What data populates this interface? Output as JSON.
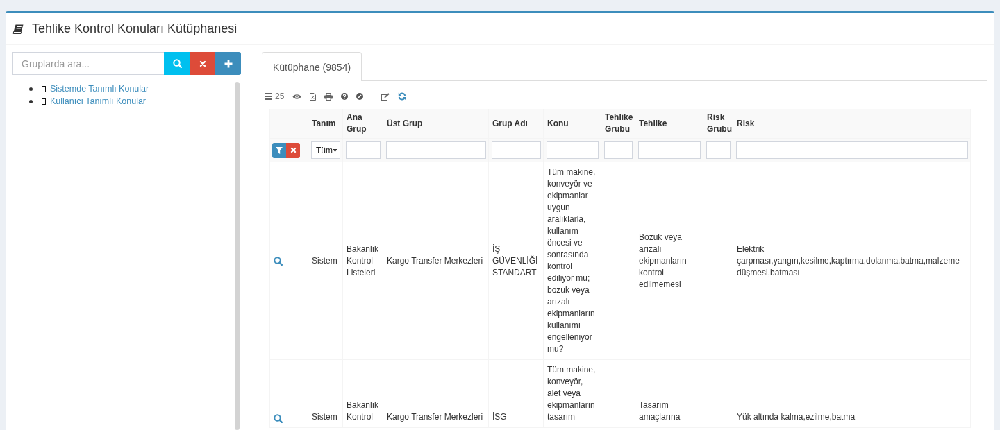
{
  "header": {
    "title": "Tehlike Kontrol Konuları Kütüphanesi"
  },
  "sidebar": {
    "search": {
      "placeholder": "Gruplarda ara..."
    },
    "buttons": [
      {
        "kind": "search"
      },
      {
        "kind": "clear"
      },
      {
        "kind": "add"
      }
    ],
    "tree": [
      {
        "label": "Sistemde Tanımlı Konular"
      },
      {
        "label": "Kullanıcı Tanımlı Konular"
      }
    ]
  },
  "tabs": [
    {
      "label": "Kütüphane (9854)",
      "selected": true
    }
  ],
  "toolbar": [
    {
      "items": [
        {
          "kind": "page_size",
          "label": "25"
        },
        {
          "kind": "columns"
        },
        {
          "kind": "excel"
        },
        {
          "kind": "print"
        },
        {
          "kind": "help"
        },
        {
          "kind": "reset"
        }
      ]
    },
    {
      "items": [
        {
          "kind": "edit"
        },
        {
          "kind": "refresh"
        }
      ]
    }
  ],
  "table": {
    "columns": [
      "Tanım",
      "Ana Grup",
      "Üst Grup",
      "Grup Adı",
      "Konu",
      "Tehlike Grubu",
      "Tehlike",
      "Risk Grubu",
      "Risk"
    ],
    "filter_buttons": [
      {
        "kind": "apply"
      },
      {
        "kind": "clear"
      }
    ],
    "filters": [
      {
        "kind": "select",
        "value": "Tüm"
      },
      {
        "kind": "text"
      },
      {
        "kind": "text"
      },
      {
        "kind": "text"
      },
      {
        "kind": "text"
      },
      {
        "kind": "text"
      },
      {
        "kind": "text"
      },
      {
        "kind": "text"
      },
      {
        "kind": "text"
      }
    ],
    "rows": [
      {
        "cells": [
          "Sistem",
          "Bakanlık Kontrol Listeleri",
          "Kargo Transfer Merkezleri",
          "İŞ GÜVENLİĞİ STANDART",
          "Tüm makine, konveyör ve ekipmanlar uygun aralıklarla, kullanım öncesi ve sonrasında kontrol ediliyor mu; bozuk veya arızalı ekipmanların kullanımı engelleniyor mu?",
          null,
          "Bozuk veya arızalı ekipmanların kontrol edilmemesi",
          null,
          "Elektrik çarpması,yangın,kesilme,kaptırma,dolanma,batma,malzeme düşmesi,batması"
        ]
      },
      {
        "cells": [
          "Sistem",
          "Bakanlık Kontrol",
          "Kargo Transfer Merkezleri",
          "İSG",
          "Tüm makine, konveyör, alet veya ekipmanların tasarım",
          null,
          "Tasarım amaçlarına",
          null,
          "Yük altında kalma,ezilme,batma"
        ]
      }
    ]
  }
}
